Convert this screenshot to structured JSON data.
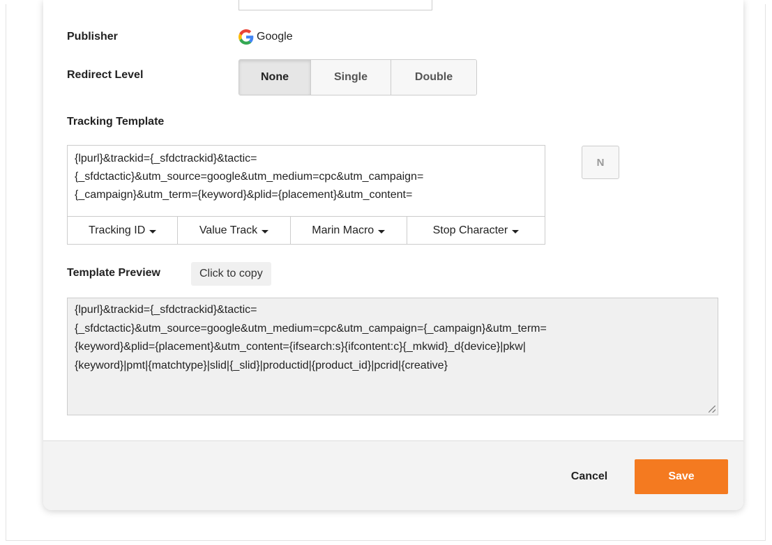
{
  "publisher": {
    "label": "Publisher",
    "value": "Google"
  },
  "redirect_level": {
    "label": "Redirect Level",
    "options": [
      "None",
      "Single",
      "Double"
    ],
    "selected": "None"
  },
  "tracking_template": {
    "label": "Tracking Template",
    "value": "{lpurl}&trackid={_sfdctrackid}&tactic=\n{_sfdctactic}&utm_source=google&utm_medium=cpc&utm_campaign=\n{_campaign}&utm_term={keyword}&plid={placement}&utm_content=",
    "toolbar": [
      "Tracking ID",
      "Value Track",
      "Marin Macro",
      "Stop Character"
    ],
    "side_button": "N"
  },
  "template_preview": {
    "label": "Template Preview",
    "copy_label": "Click to copy",
    "value": "{lpurl}&trackid={_sfdctrackid}&tactic=\n{_sfdctactic}&utm_source=google&utm_medium=cpc&utm_campaign={_campaign}&utm_term=\n{keyword}&plid={placement}&utm_content={ifsearch:s}{ifcontent:c}{_mkwid}_d{device}|pkw|\n{keyword}|pmt|{matchtype}|slid|{_slid}|productid|{product_id}|pcrid|{creative}"
  },
  "footer": {
    "cancel_label": "Cancel",
    "save_label": "Save"
  },
  "colors": {
    "save_button": "#f47a20",
    "preview_background": "#f0f0f0",
    "footer_background": "#f3f3f3"
  }
}
